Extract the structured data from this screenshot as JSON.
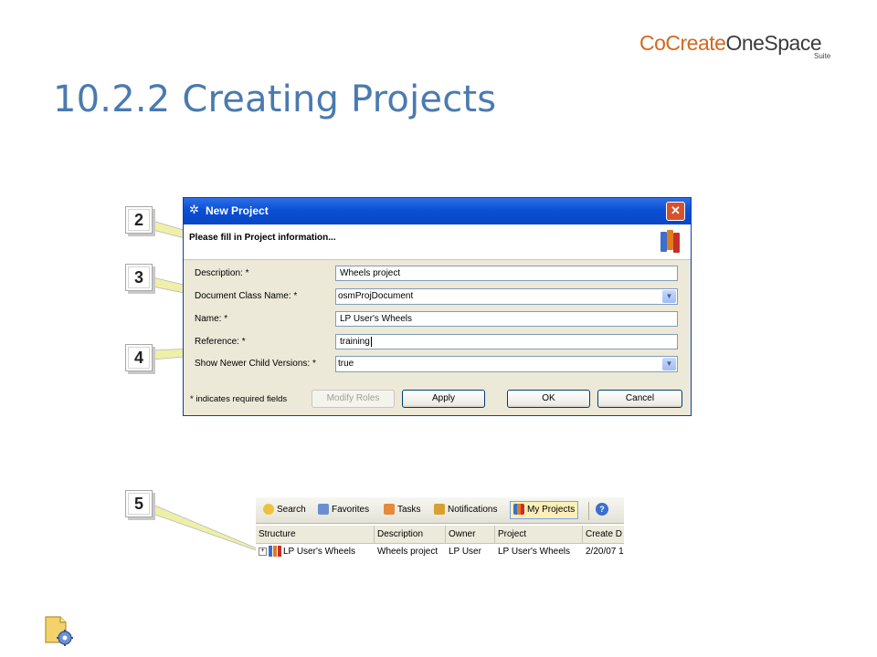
{
  "slide": {
    "title": "10.2.2 Creating Projects"
  },
  "brand": {
    "cocreate": "CoCreate",
    "onespace": "OneSpace",
    "suite": "Suite"
  },
  "callouts": [
    "2",
    "3",
    "4",
    "5"
  ],
  "dialog": {
    "title": "New Project",
    "instruction": "Please fill in Project information...",
    "fields": {
      "description": {
        "label": "Description: *",
        "value": "Wheels project"
      },
      "doc_class": {
        "label": "Document Class Name: *",
        "value": "osmProjDocument"
      },
      "name": {
        "label": "Name: *",
        "value": "LP User's Wheels"
      },
      "reference": {
        "label": "Reference: *",
        "value": "training"
      },
      "show_newer": {
        "label": "Show Newer Child Versions: *",
        "value": "true"
      }
    },
    "required_note": "* indicates required fields",
    "buttons": {
      "modify_roles": "Modify Roles",
      "apply": "Apply",
      "ok": "OK",
      "cancel": "Cancel"
    },
    "close_glyph": "✕"
  },
  "workspace": {
    "toolbar": [
      "Search",
      "Favorites",
      "Tasks",
      "Notifications",
      "My Projects"
    ],
    "active_tab": "My Projects",
    "columns": [
      "Structure",
      "Description",
      "Owner",
      "Project",
      "Create D"
    ],
    "row": {
      "structure": "LP User's Wheels",
      "description": "Wheels project",
      "owner": "LP User",
      "project": "LP User's Wheels",
      "create_date": "2/20/07 1"
    }
  },
  "colors": {
    "title_blue": "#4a7ab0",
    "titlebar_blue": "#0b4fd6",
    "brand_orange": "#d2691e"
  }
}
